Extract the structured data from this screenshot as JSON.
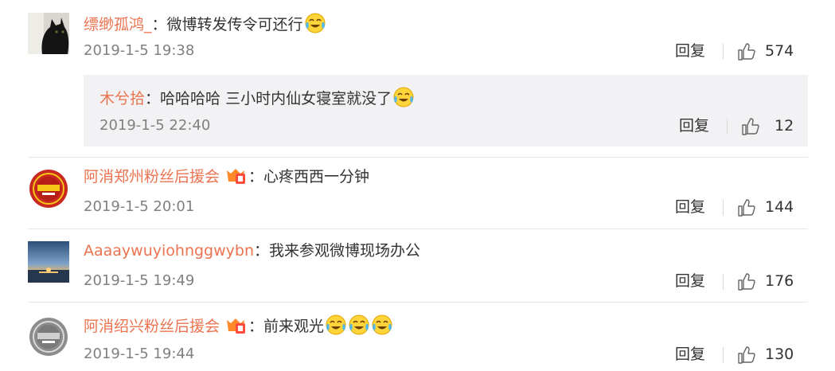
{
  "comments": [
    {
      "username": "缥缈孤鸿_",
      "colon": "：",
      "text": "微博转发传令可还行",
      "time": "2019-1-5 19:38",
      "reply_label": "回复",
      "likes": "574",
      "avatar": "black-cat-avatar",
      "emoji": "crying-laughing-emoji",
      "sub_reply": {
        "username": "木兮拾",
        "colon": "：",
        "text": "哈哈哈哈 三小时内仙女寝室就没了",
        "time": "2019-1-5 22:40",
        "reply_label": "回复",
        "likes": "12",
        "emoji": "laughing-tears-emoji"
      }
    },
    {
      "username": "阿消郑州粉丝后援会",
      "colon": "：",
      "text": "心疼西西一分钟",
      "time": "2019-1-5 20:01",
      "reply_label": "回复",
      "likes": "144",
      "avatar": "fans-club-red-seal-avatar",
      "badge": "fan-level-badge"
    },
    {
      "username": "Aaaaywuyiohnggwybn",
      "colon": "：",
      "text": "我来参观微博现场办公",
      "time": "2019-1-5 19:49",
      "reply_label": "回复",
      "likes": "176",
      "avatar": "sunset-landscape-avatar"
    },
    {
      "username": "阿消绍兴粉丝后援会",
      "colon": "：",
      "text": "前来观光",
      "time": "2019-1-5 19:44",
      "reply_label": "回复",
      "likes": "130",
      "avatar": "fans-club-grey-seal-avatar",
      "badge": "fan-level-badge"
    }
  ],
  "colors": {
    "username": "#eb7350",
    "text": "#333333",
    "meta": "#808080",
    "subreply_bg": "#f2f2f5",
    "divider": "#e6e6e6"
  }
}
